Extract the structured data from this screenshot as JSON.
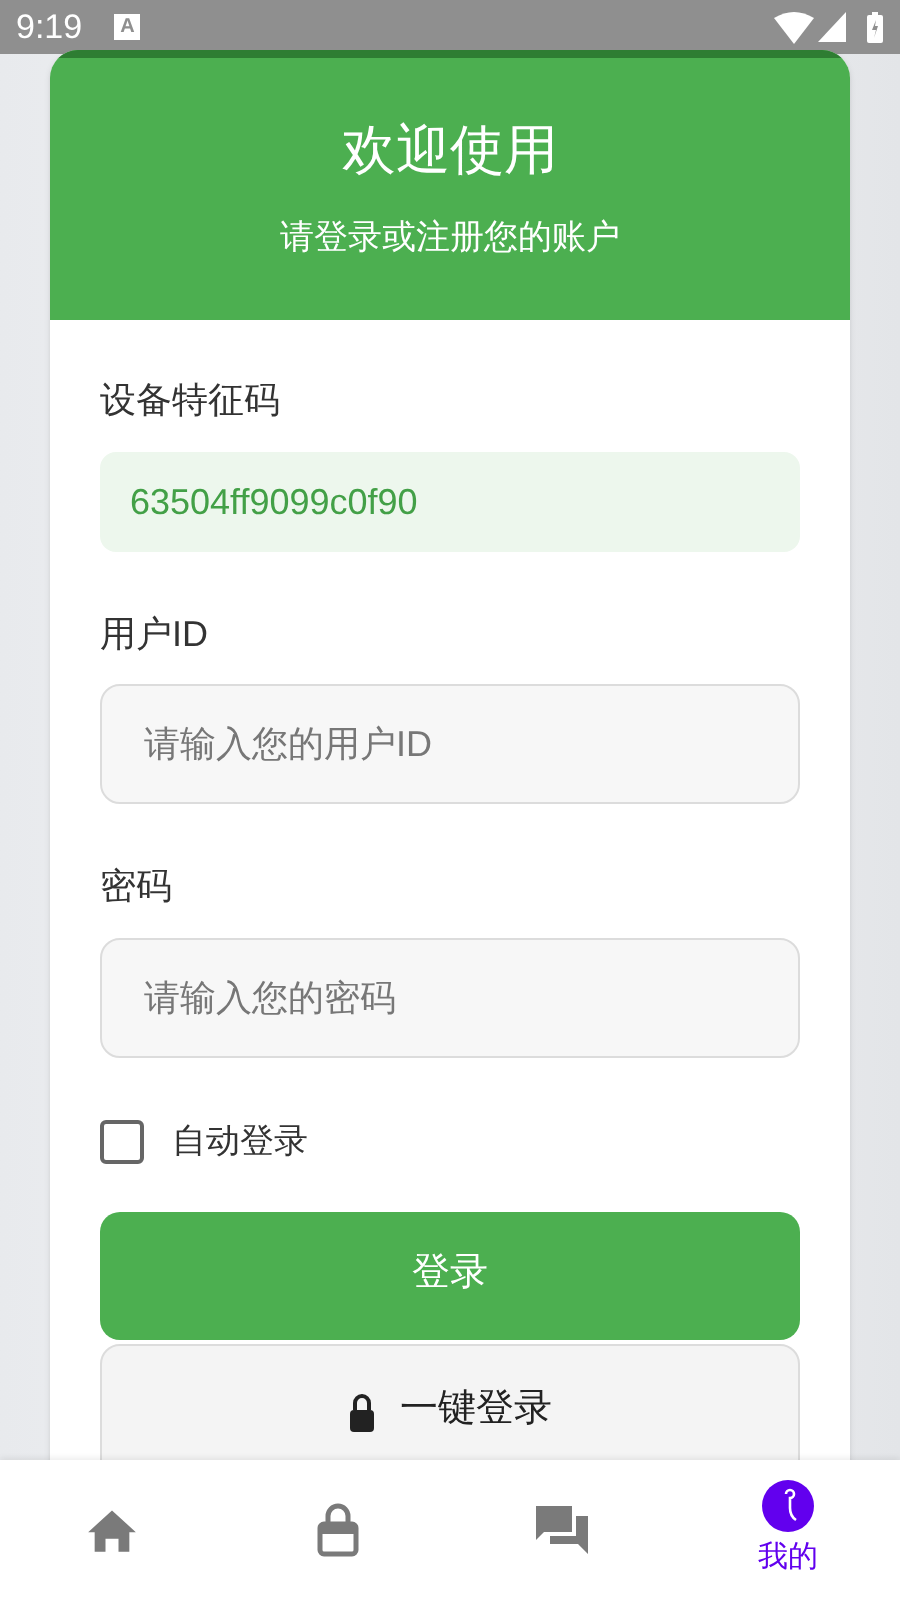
{
  "status_bar": {
    "time": "9:19",
    "badge": "A"
  },
  "header": {
    "title": "欢迎使用",
    "subtitle": "请登录或注册您的账户"
  },
  "device_code": {
    "label": "设备特征码",
    "value": "63504ff9099c0f90"
  },
  "user_id": {
    "label": "用户ID",
    "placeholder": "请输入您的用户ID"
  },
  "password": {
    "label": "密码",
    "placeholder": "请输入您的密码"
  },
  "auto_login": {
    "label": "自动登录",
    "checked": false
  },
  "login_button": "登录",
  "quick_login_button": "一键登录",
  "nav": [
    {
      "kind": "home",
      "selected": false
    },
    {
      "kind": "lock",
      "selected": false
    },
    {
      "kind": "chat",
      "selected": false
    },
    {
      "kind": "profile",
      "label": "我的",
      "selected": true
    }
  ]
}
